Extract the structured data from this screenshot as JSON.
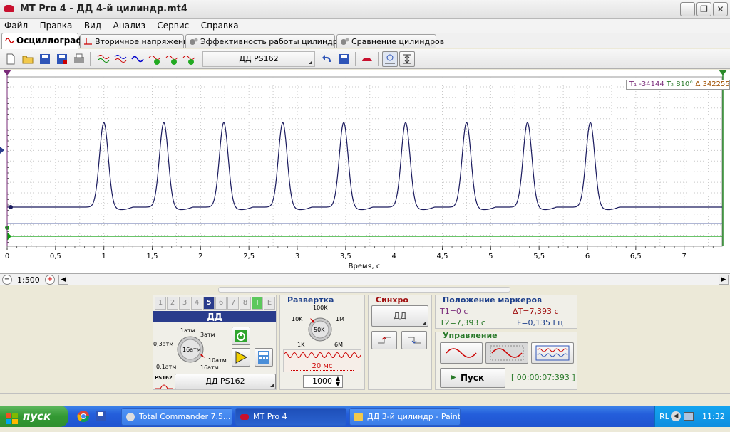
{
  "window": {
    "title": "MT Pro 4 - ДД 4-й цилиндр.mt4"
  },
  "menu": [
    "Файл",
    "Правка",
    "Вид",
    "Анализ",
    "Сервис",
    "Справка"
  ],
  "tabs": [
    {
      "label": "Осциллограф",
      "active": true
    },
    {
      "label": "Вторичное напряжение",
      "active": false
    },
    {
      "label": "Эффективность работы цилиндров",
      "active": false
    },
    {
      "label": "Сравнение цилиндров",
      "active": false
    }
  ],
  "toolbar": {
    "sensor_select": "ДД PS162"
  },
  "marker_readout": {
    "t1": "-34144",
    "t2": "810°",
    "delta": "342255"
  },
  "chart_data": {
    "type": "line",
    "xlabel": "Время, с",
    "x_ticks": [
      "0",
      "0,5",
      "1",
      "1,5",
      "2",
      "2,5",
      "3",
      "3,5",
      "4",
      "4,5",
      "5",
      "5,5",
      "6",
      "6,5",
      "7"
    ],
    "xlim": [
      0,
      7.393
    ],
    "baseline_level": 0,
    "peak_times": [
      1.0,
      1.62,
      2.24,
      2.85,
      3.48,
      4.12,
      4.75,
      5.38,
      6.03
    ],
    "peak_level": 1,
    "grid": true,
    "series": [
      {
        "color": "#1a1a5e"
      },
      {
        "color": "#10a010"
      }
    ]
  },
  "zoom": {
    "scale": "1:500"
  },
  "channel": {
    "tabs": [
      "1",
      "2",
      "3",
      "4",
      "5",
      "6",
      "7",
      "8",
      "T",
      "E"
    ],
    "active": "5",
    "name": "ДД",
    "knob_labels": [
      "1атм",
      "3атм",
      "0,3атм",
      "16атм",
      "10атм",
      "0,1атм",
      "16атм"
    ],
    "sensor_badge": "PS162",
    "sensor": "ДД PS162"
  },
  "sweep": {
    "title": "Развертка",
    "knob_labels": [
      "100K",
      "10K",
      "1M",
      "50K",
      "1K",
      "6M"
    ],
    "time_div": "20 мс",
    "points": "1000"
  },
  "sync": {
    "title": "Синхро",
    "source": "ДД"
  },
  "markers": {
    "title": "Положение маркеров",
    "t1": "T1=0 с",
    "dt": "ΔT=7,393 с",
    "t2": "T2=7,393 с",
    "f": "F=0,135 Гц"
  },
  "control": {
    "title": "Управление",
    "start_label": "Пуск",
    "timer": "[ 00:00:07:393 ]"
  },
  "taskbar": {
    "start": "пуск",
    "tasks": [
      "Total Commander 7.5...",
      "MT Pro 4",
      "ДД 3-й цилиндр - Paint"
    ],
    "lang": "RL",
    "clock": "11:32"
  },
  "colors": {
    "trace": "#1a1a5e",
    "sync_line": "#10a010",
    "accent": "#2a3c8c"
  }
}
